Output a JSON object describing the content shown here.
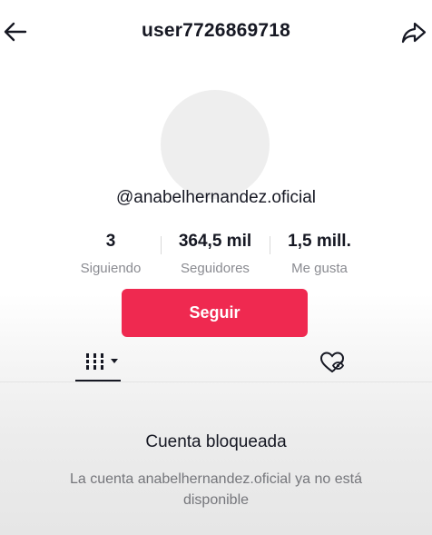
{
  "header": {
    "title": "user7726869718",
    "back_icon": "arrow-left-icon",
    "share_icon": "share-arrow-icon"
  },
  "profile": {
    "avatar": "avatar-placeholder",
    "handle": "@anabelhernandez.oficial"
  },
  "stats": [
    {
      "value": "3",
      "label": "Siguiendo"
    },
    {
      "value": "364,5 mil",
      "label": "Seguidores"
    },
    {
      "value": "1,5 mill.",
      "label": "Me gusta"
    }
  ],
  "actions": {
    "follow_label": "Seguir",
    "follow_color": "#ef2950"
  },
  "tabs": {
    "videos_icon": "grid-icon",
    "videos_dropdown_icon": "caret-down-icon",
    "liked_icon": "hidden-heart-icon"
  },
  "blocked": {
    "title": "Cuenta bloqueada",
    "message": "La cuenta anabelhernandez.oficial ya no está disponible"
  }
}
